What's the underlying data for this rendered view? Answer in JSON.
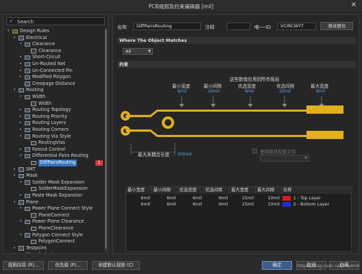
{
  "window": {
    "title": "PCB规则及约束编辑器 [mil]",
    "close_glyph": "✕"
  },
  "search": {
    "placeholder": "Search"
  },
  "tree": [
    {
      "label": "Design Rules",
      "level": 0,
      "arrow": "▾",
      "icon": "folder"
    },
    {
      "label": "Electrical",
      "level": 1,
      "arrow": "▾",
      "icon": "node"
    },
    {
      "label": "Clearance",
      "level": 2,
      "arrow": "▾",
      "icon": "node"
    },
    {
      "label": "Clearance",
      "level": 3,
      "arrow": "",
      "icon": "rule"
    },
    {
      "label": "Short-Circuit",
      "level": 2,
      "arrow": "▸",
      "icon": "node"
    },
    {
      "label": "Un-Routed Net",
      "level": 2,
      "arrow": "▸",
      "icon": "node"
    },
    {
      "label": "Un-Connected Pin",
      "level": 2,
      "arrow": "▸",
      "icon": "node"
    },
    {
      "label": "Modified Polygon",
      "level": 2,
      "arrow": "▸",
      "icon": "node"
    },
    {
      "label": "Creepage Distance",
      "level": 2,
      "arrow": "",
      "icon": "node"
    },
    {
      "label": "Routing",
      "level": 1,
      "arrow": "▾",
      "icon": "node"
    },
    {
      "label": "Width",
      "level": 2,
      "arrow": "▾",
      "icon": "node"
    },
    {
      "label": "Width",
      "level": 3,
      "arrow": "",
      "icon": "rule"
    },
    {
      "label": "Routing Topology",
      "level": 2,
      "arrow": "▸",
      "icon": "node"
    },
    {
      "label": "Routing Priority",
      "level": 2,
      "arrow": "▸",
      "icon": "node"
    },
    {
      "label": "Routing Layers",
      "level": 2,
      "arrow": "▸",
      "icon": "node"
    },
    {
      "label": "Routing Corners",
      "level": 2,
      "arrow": "▸",
      "icon": "node"
    },
    {
      "label": "Routing Via Style",
      "level": 2,
      "arrow": "▾",
      "icon": "node"
    },
    {
      "label": "RoutingVias",
      "level": 3,
      "arrow": "",
      "icon": "rule"
    },
    {
      "label": "Fanout Control",
      "level": 2,
      "arrow": "▸",
      "icon": "node"
    },
    {
      "label": "Differential Pairs Routing",
      "level": 2,
      "arrow": "▾",
      "icon": "node"
    },
    {
      "label": "DiffPairsRouting",
      "level": 3,
      "arrow": "",
      "icon": "rule",
      "selected": true,
      "badge": "1"
    },
    {
      "label": "SMT",
      "level": 1,
      "arrow": "▸",
      "icon": "node"
    },
    {
      "label": "Mask",
      "level": 1,
      "arrow": "▾",
      "icon": "node"
    },
    {
      "label": "Solder Mask Expansion",
      "level": 2,
      "arrow": "▾",
      "icon": "node"
    },
    {
      "label": "SolderMaskExpansion",
      "level": 3,
      "arrow": "",
      "icon": "rule"
    },
    {
      "label": "Paste Mask Expansion",
      "level": 2,
      "arrow": "▸",
      "icon": "node"
    },
    {
      "label": "Plane",
      "level": 1,
      "arrow": "▾",
      "icon": "node"
    },
    {
      "label": "Power Plane Connect Style",
      "level": 2,
      "arrow": "▾",
      "icon": "node"
    },
    {
      "label": "PlaneConnect",
      "level": 3,
      "arrow": "",
      "icon": "rule"
    },
    {
      "label": "Power Plane Clearance",
      "level": 2,
      "arrow": "▾",
      "icon": "node"
    },
    {
      "label": "PlaneClearance",
      "level": 3,
      "arrow": "",
      "icon": "rule"
    },
    {
      "label": "Polygon Connect Style",
      "level": 2,
      "arrow": "▾",
      "icon": "node"
    },
    {
      "label": "PolygonConnect",
      "level": 3,
      "arrow": "",
      "icon": "rule"
    },
    {
      "label": "Testpoint",
      "level": 1,
      "arrow": "▸",
      "icon": "node"
    },
    {
      "label": "Manufacturing",
      "level": 1,
      "arrow": "▸",
      "icon": "node"
    }
  ],
  "rule": {
    "name_label": "名称",
    "name_value": "DiffPairsRouting",
    "comment_label": "注释",
    "comment_value": "",
    "uid_label": "唯一-ID",
    "uid_value": "VCIRCWYT",
    "test_button": "测试语句"
  },
  "where": {
    "heading": "Where The Object Matches",
    "scope": "All"
  },
  "constraints": {
    "heading": "约束",
    "layer_note": "这些数值应用到所有板层",
    "labels": {
      "min_width": "最小宽度",
      "min_gap": "最小间隙",
      "pref_width": "优选宽度",
      "pref_gap": "优选间隙",
      "max_width": "最大宽度",
      "max_uncoupled": "最大未耦合长度",
      "use_impedance": "使用阻抗配置文件"
    },
    "values": {
      "min_width": "6mil",
      "min_gap": "10mil",
      "pref_width": "6mil",
      "pref_gap": "10mil",
      "max_width": "6mil",
      "max_uncoupled": "500mil"
    }
  },
  "layer_table": {
    "headers": [
      "最小宽度",
      "最小间隙",
      "优选宽度",
      "优选间距",
      "最大宽度",
      "最大间隙",
      "名称"
    ],
    "rows": [
      {
        "cells": [
          "6mil",
          "6mil",
          "6mil",
          "6mil",
          "15mil",
          "10mil"
        ],
        "color": "#e01818",
        "name": "1 - Top Layer"
      },
      {
        "cells": [
          "6mil",
          "6mil",
          "6mil",
          "6mil",
          "15mil",
          "10mil"
        ],
        "color": "#1a32d8",
        "name": "2 - Bottom Layer"
      }
    ]
  },
  "bottom": {
    "rules_wizard": "规则向导 (R)...",
    "priorities": "优先级 (P)...",
    "create_default": "创建默认规则 (C)",
    "ok": "确定",
    "cancel": "取消",
    "apply": "应用",
    "watermark": "https://blog.csdn.net/Madmd"
  },
  "colors": {
    "track": "#e1b11c",
    "accent": "#5aa9f0",
    "selection": "#3574c0"
  }
}
